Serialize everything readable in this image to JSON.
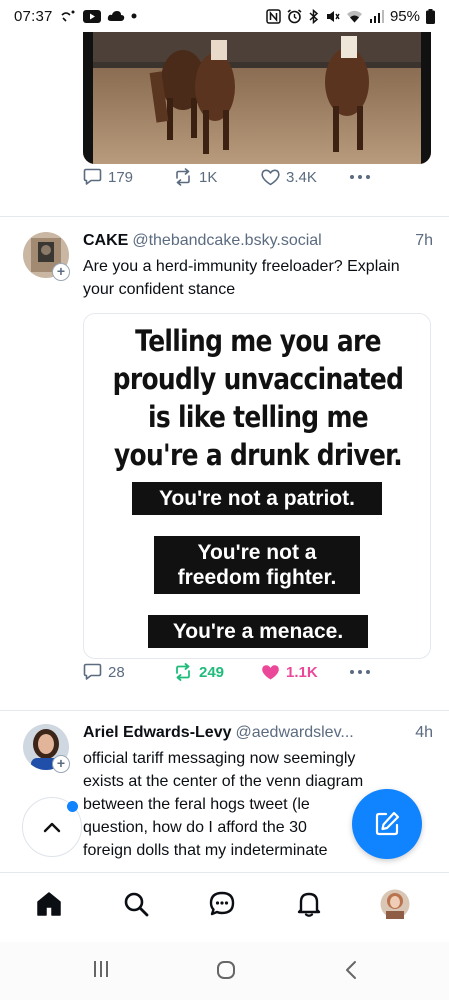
{
  "status_bar": {
    "time": "07:37",
    "battery": "95%",
    "left_icons": [
      "wifi-call-icon",
      "youtube-icon",
      "cloud-icon",
      "dot-icon"
    ],
    "right_icons": [
      "nfc-icon",
      "alarm-icon",
      "bluetooth-icon",
      "mute-icon",
      "wifi-icon",
      "signal-icon",
      "battery-icon"
    ]
  },
  "feed": {
    "post1": {
      "replies": "179",
      "reposts": "1K",
      "likes": "3.4K"
    },
    "post2": {
      "author_name": "CAKE",
      "author_handle": "@thebandcake.bsky.social",
      "time": "7h",
      "text": "Are you a herd-immunity freeloader? Explain your confident stance",
      "image": {
        "headline": [
          "Telling me you are",
          "proudly unvaccinated",
          "is like telling me",
          "you're a drunk driver."
        ],
        "box1": "You're not a patriot.",
        "box2": [
          "You're not a",
          "freedom fighter."
        ],
        "box3": "You're a menace."
      },
      "replies": "28",
      "reposts": "249",
      "likes": "1.1K",
      "repost_color": "#20bc7b",
      "like_color": "#ec4899"
    },
    "post3": {
      "author_name": "Ariel Edwards-Levy",
      "author_handle": "@aedwardslev...",
      "time": "4h",
      "text_lines": [
        "official tariff messaging now seemingly",
        "exists at the center of the venn diagram",
        "between the feral hogs tweet (le",
        "question, how do I afford the 30",
        "foreign dolls that my indeterminate"
      ]
    }
  },
  "colors": {
    "accent": "#1083fe",
    "muted": "#5b6b80"
  },
  "bottom_nav": [
    "home-icon",
    "search-icon",
    "chat-icon",
    "bell-icon",
    "profile-avatar"
  ],
  "system_nav": [
    "recents-button",
    "home-button",
    "back-button"
  ]
}
